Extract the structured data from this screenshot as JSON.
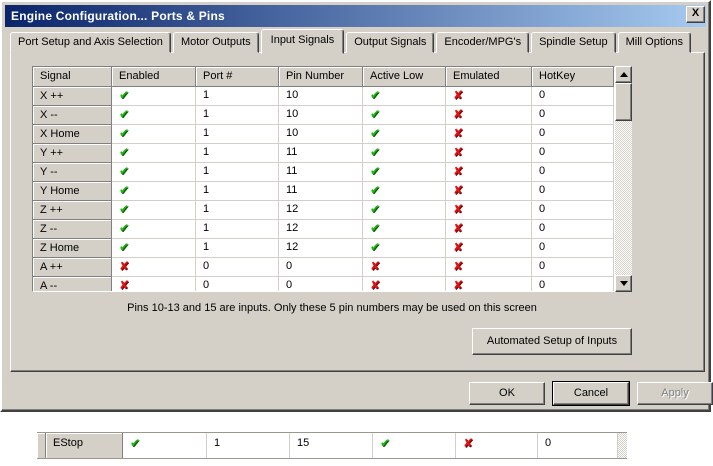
{
  "window": {
    "title": "Engine Configuration... Ports & Pins",
    "close_glyph": "X"
  },
  "tabs": [
    {
      "label": "Port Setup and Axis Selection",
      "active": false
    },
    {
      "label": "Motor Outputs",
      "active": false
    },
    {
      "label": "Input Signals",
      "active": true
    },
    {
      "label": "Output Signals",
      "active": false
    },
    {
      "label": "Encoder/MPG's",
      "active": false
    },
    {
      "label": "Spindle Setup",
      "active": false
    },
    {
      "label": "Mill Options",
      "active": false
    }
  ],
  "table": {
    "columns": [
      "Signal",
      "Enabled",
      "Port #",
      "Pin Number",
      "Active Low",
      "Emulated",
      "HotKey"
    ],
    "rows": [
      {
        "signal": "X ++",
        "enabled": true,
        "port": "1",
        "pin": "10",
        "active_low": true,
        "emulated": false,
        "hotkey": "0"
      },
      {
        "signal": "X --",
        "enabled": true,
        "port": "1",
        "pin": "10",
        "active_low": true,
        "emulated": false,
        "hotkey": "0"
      },
      {
        "signal": "X Home",
        "enabled": true,
        "port": "1",
        "pin": "10",
        "active_low": true,
        "emulated": false,
        "hotkey": "0"
      },
      {
        "signal": "Y ++",
        "enabled": true,
        "port": "1",
        "pin": "11",
        "active_low": true,
        "emulated": false,
        "hotkey": "0"
      },
      {
        "signal": "Y --",
        "enabled": true,
        "port": "1",
        "pin": "11",
        "active_low": true,
        "emulated": false,
        "hotkey": "0"
      },
      {
        "signal": "Y Home",
        "enabled": true,
        "port": "1",
        "pin": "11",
        "active_low": true,
        "emulated": false,
        "hotkey": "0"
      },
      {
        "signal": "Z ++",
        "enabled": true,
        "port": "1",
        "pin": "12",
        "active_low": true,
        "emulated": false,
        "hotkey": "0"
      },
      {
        "signal": "Z --",
        "enabled": true,
        "port": "1",
        "pin": "12",
        "active_low": true,
        "emulated": false,
        "hotkey": "0"
      },
      {
        "signal": "Z Home",
        "enabled": true,
        "port": "1",
        "pin": "12",
        "active_low": true,
        "emulated": false,
        "hotkey": "0"
      },
      {
        "signal": "A ++",
        "enabled": false,
        "port": "0",
        "pin": "0",
        "active_low": false,
        "emulated": false,
        "hotkey": "0"
      },
      {
        "signal": "A --",
        "enabled": false,
        "port": "0",
        "pin": "0",
        "active_low": false,
        "emulated": false,
        "hotkey": "0"
      }
    ]
  },
  "estop_row": {
    "signal": "EStop",
    "enabled": true,
    "port": "1",
    "pin": "15",
    "active_low": true,
    "emulated": false,
    "hotkey": "0"
  },
  "note": "Pins 10-13 and 15 are inputs. Only these 5 pin numbers may be used on this screen",
  "buttons": {
    "automated": "Automated Setup of Inputs",
    "ok": "OK",
    "cancel": "Cancel",
    "apply": "Apply"
  },
  "icons": {
    "check": "✔",
    "cross": "✘"
  },
  "colors": {
    "dialog_bg": "#d4d0c8",
    "titlebar_left": "#0a246a",
    "titlebar_right": "#a6caf0",
    "check_green": "#1db50f",
    "cross_red": "#dd1414"
  }
}
